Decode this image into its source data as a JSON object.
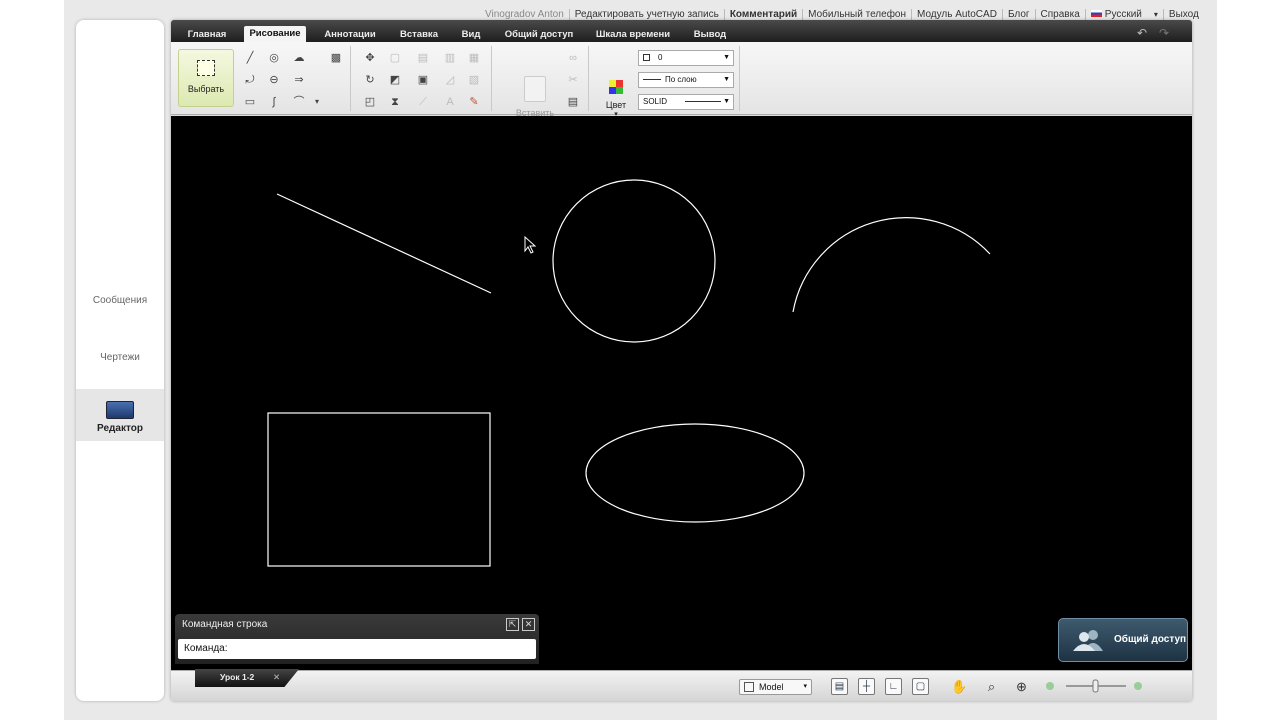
{
  "top_links": [
    {
      "label": "Vinogradov Anton",
      "bold": false
    },
    {
      "label": "Редактировать учетную запись",
      "bold": false
    },
    {
      "label": "Комментарий",
      "bold": true
    },
    {
      "label": "Мобильный телефон",
      "bold": false
    },
    {
      "label": "Модуль AutoCAD",
      "bold": false
    },
    {
      "label": "Блог",
      "bold": false
    },
    {
      "label": "Справка",
      "bold": false
    },
    {
      "label": "Русский",
      "bold": false
    },
    {
      "label": "Выход",
      "bold": false
    }
  ],
  "left_nav": {
    "messages": "Сообщения",
    "drawings": "Чертежи",
    "editor": "Редактор"
  },
  "ribbon_tabs": [
    "Главная",
    "Рисование",
    "Аннотации",
    "Вставка",
    "Вид",
    "Общий доступ",
    "Шкала времени",
    "Вывод"
  ],
  "active_tab": "Рисование",
  "ribbon": {
    "select_label": "Выбрать",
    "paste_label": "Вставить",
    "color_label": "Цвет",
    "layer_value": "0",
    "linetype_value": "По слою",
    "lineweight_value": "SOLID"
  },
  "command_line": {
    "title": "Командная строка",
    "prompt": "Команда:"
  },
  "share_button": "Общий доступ",
  "doc_tab": "Урок 1-2",
  "model_tab": "Model",
  "colors": {
    "canvas": "#000000",
    "stroke": "#ffffff",
    "tab_active": "#f4f4f4",
    "share_bg": "#2c4558"
  },
  "icons": {
    "undo": "undo-icon",
    "redo": "redo-icon",
    "pan": "hand-icon",
    "zoom": "zoom-icon",
    "zoom_extents": "zoom-extents-icon"
  }
}
